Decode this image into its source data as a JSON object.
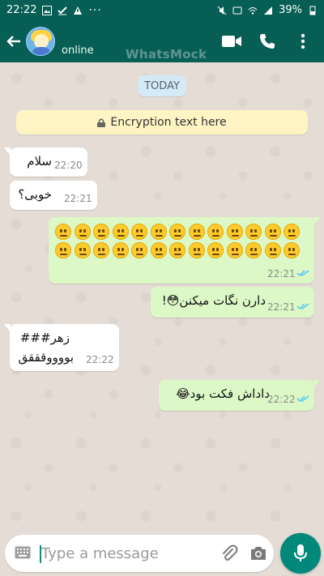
{
  "status_bar": {
    "time": "22:22",
    "more_indicator": "···",
    "battery_level": "39%",
    "icons": [
      "gallery-icon",
      "check-icon",
      "warning-icon",
      "mute-icon",
      "volte-icon",
      "wifi-icon",
      "signal-icon",
      "battery-icon"
    ]
  },
  "header": {
    "contact_name": "",
    "contact_status": "online",
    "watermark": "WhatsMock",
    "icons": [
      "back-arrow-icon",
      "avatar",
      "video-call-icon",
      "voice-call-icon",
      "more-vert-icon"
    ],
    "color": "#075e54"
  },
  "chat": {
    "date_chip": "TODAY",
    "encryption_notice": "Encryption text here",
    "messages": [
      {
        "direction": "in",
        "text": "سلام",
        "time": "22:20"
      },
      {
        "direction": "in",
        "text": "خوبی؟",
        "time": "22:21"
      },
      {
        "direction": "out",
        "text": "",
        "emoji": "neutral-face",
        "emoji_count": 26,
        "time": "22:21",
        "read": true
      },
      {
        "direction": "out",
        "text": "دارن نگات میکنن😳!",
        "time": "22:21",
        "read": true
      },
      {
        "direction": "in",
        "text": "زهر###",
        "text2": "بووووقققق",
        "time": "22:22"
      },
      {
        "direction": "out",
        "text": "داداش فکت بود😂",
        "time": "22:22",
        "read": true
      }
    ],
    "colors": {
      "incoming": "#ffffff",
      "outgoing": "#dcf8c6",
      "read_ticks": "#4fc3f7",
      "background": "#e5ddd5"
    }
  },
  "composer": {
    "placeholder": "Type a message",
    "value": "",
    "icons": [
      "keyboard-icon",
      "attach-icon",
      "camera-icon",
      "mic-icon"
    ],
    "send_color": "#00897b"
  }
}
